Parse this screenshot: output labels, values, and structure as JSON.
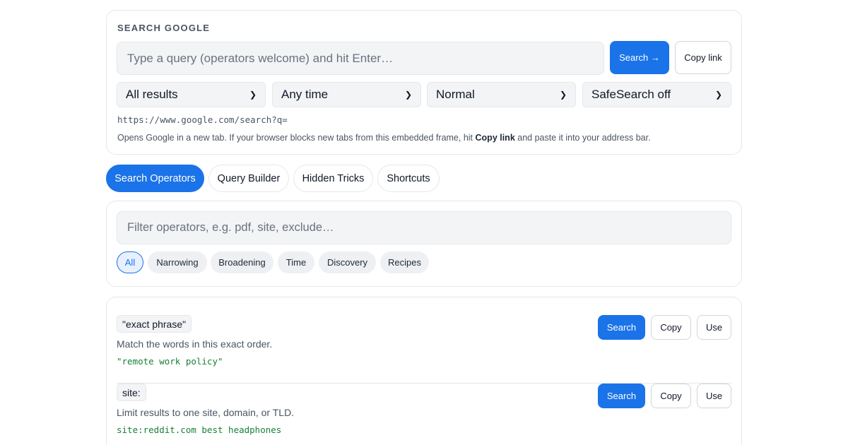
{
  "search_panel": {
    "heading": "SEARCH GOOGLE",
    "query_placeholder": "Type a query (operators welcome) and hit Enter…",
    "search_button": "Search →",
    "copy_link_button": "Copy link",
    "selects": [
      {
        "value": "All results"
      },
      {
        "value": "Any time"
      },
      {
        "value": "Normal"
      },
      {
        "value": "SafeSearch off"
      }
    ],
    "url_preview": "https://www.google.com/search?q=",
    "help_text_before": "Opens Google in a new tab. If your browser blocks new tabs from this embedded frame, hit ",
    "help_text_bold": "Copy link",
    "help_text_after": " and paste it into your address bar."
  },
  "tabs": [
    {
      "label": "Search Operators",
      "active": true
    },
    {
      "label": "Query Builder",
      "active": false
    },
    {
      "label": "Hidden Tricks",
      "active": false
    },
    {
      "label": "Shortcuts",
      "active": false
    }
  ],
  "filter": {
    "placeholder": "Filter operators, e.g. pdf, site, exclude…",
    "chips": [
      {
        "label": "All",
        "active": true
      },
      {
        "label": "Narrowing",
        "active": false
      },
      {
        "label": "Broadening",
        "active": false
      },
      {
        "label": "Time",
        "active": false
      },
      {
        "label": "Discovery",
        "active": false
      },
      {
        "label": "Recipes",
        "active": false
      }
    ]
  },
  "operators": [
    {
      "operator": "\"exact phrase\"",
      "description": "Match the words in this exact order.",
      "example": "\"remote work policy\"",
      "search_button": "Search",
      "copy_button": "Copy",
      "use_button": "Use"
    },
    {
      "operator": "site:",
      "description": "Limit results to one site, domain, or TLD.",
      "example": "site:reddit.com best headphones",
      "search_button": "Search",
      "copy_button": "Copy",
      "use_button": "Use"
    }
  ],
  "colors": {
    "accent": "#1a73e8",
    "example_text": "#188038",
    "border": "#e5e7eb"
  }
}
